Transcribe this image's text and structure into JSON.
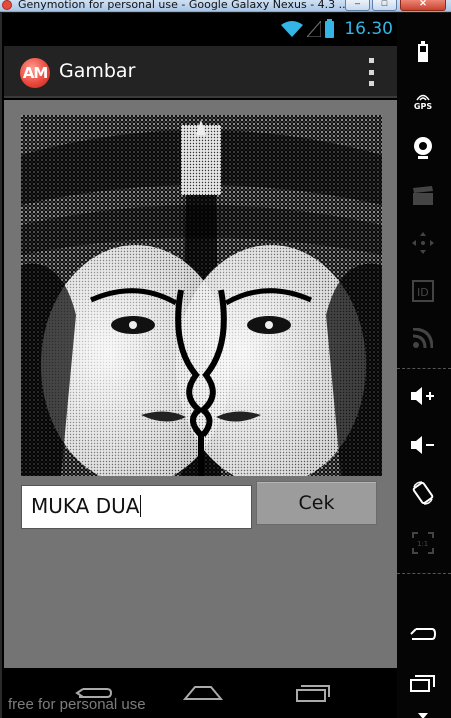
{
  "window": {
    "title": "Genymotion for personal use - Google Galaxy Nexus - 4.3 ...",
    "close_label": "✕"
  },
  "statusbar": {
    "time": "16.30"
  },
  "app": {
    "logo_text": "AM",
    "title": "Gambar"
  },
  "main": {
    "image_alt": "face illusion image",
    "input_value": "MUKA DUA",
    "button_label": "Cek"
  },
  "watermark": "free for personal use",
  "toolbar": {
    "gps_label": "GPS",
    "items": [
      "battery-icon",
      "gps-icon",
      "webcam-icon",
      "clapperboard-icon",
      "move-icon",
      "id-icon",
      "rss-icon",
      "volume-up-icon",
      "volume-down-icon",
      "rotate-icon",
      "scale-icon",
      "back-icon",
      "recent-apps-icon",
      "menu-down-icon"
    ]
  },
  "colors": {
    "accent": "#33b5e5",
    "app_bg": "#747474",
    "actionbar": "#232323"
  }
}
